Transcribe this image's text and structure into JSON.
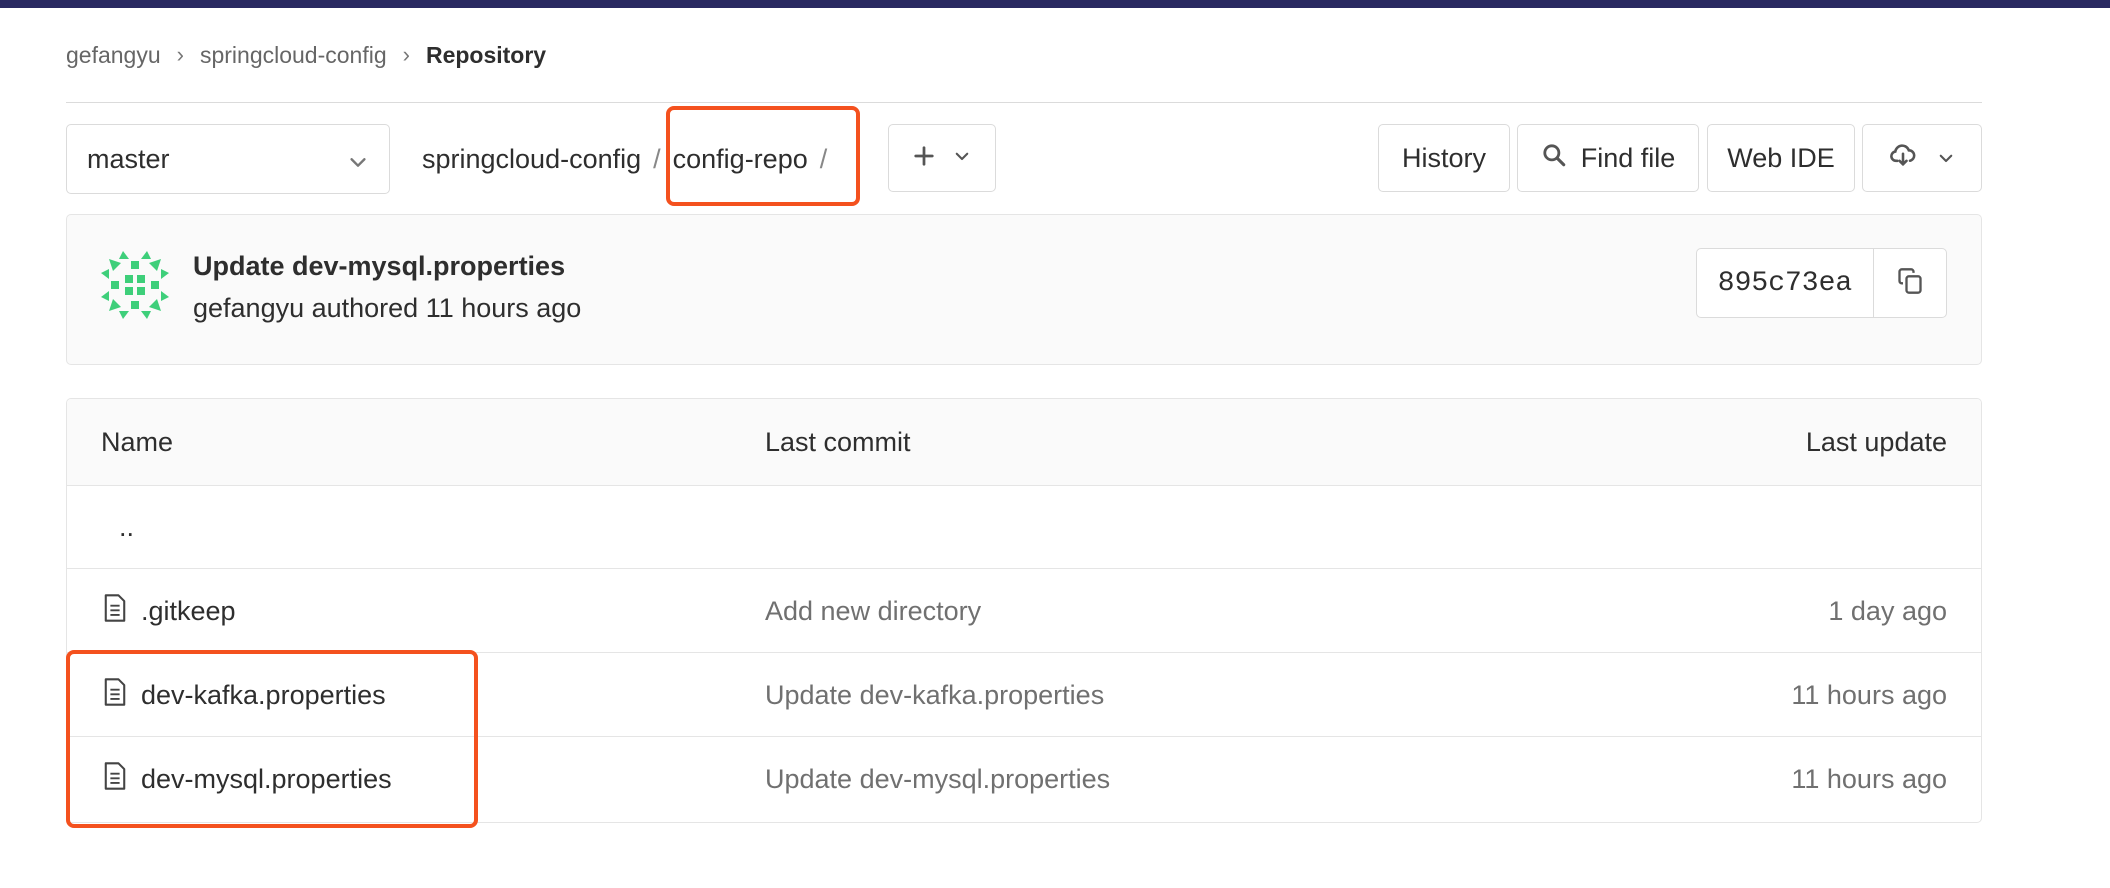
{
  "breadcrumbs": {
    "items": [
      "gefangyu",
      "springcloud-config"
    ],
    "current": "Repository",
    "separator": "›"
  },
  "toolbar": {
    "branch": "master",
    "path_root": "springcloud-config",
    "path_segment": "config-repo",
    "path_sep": "/",
    "history_label": "History",
    "find_file_label": "Find file",
    "web_ide_label": "Web IDE"
  },
  "last_commit": {
    "title": "Update dev-mysql.properties",
    "meta": "gefangyu authored 11 hours ago",
    "sha": "895c73ea"
  },
  "table": {
    "headers": {
      "name": "Name",
      "last_commit": "Last commit",
      "last_update": "Last update"
    },
    "parent_dir": "..",
    "rows": [
      {
        "name": ".gitkeep",
        "commit": "Add new directory",
        "updated": "1 day ago"
      },
      {
        "name": "dev-kafka.properties",
        "commit": "Update dev-kafka.properties",
        "updated": "11 hours ago"
      },
      {
        "name": "dev-mysql.properties",
        "commit": "Update dev-mysql.properties",
        "updated": "11 hours ago"
      }
    ]
  },
  "colors": {
    "topbar": "#292961",
    "highlight": "#f4511e",
    "avatar": "#3ecf7a"
  },
  "icons": [
    "chevron-down-icon",
    "plus-icon",
    "search-icon",
    "cloud-download-icon",
    "copy-icon",
    "file-icon"
  ]
}
